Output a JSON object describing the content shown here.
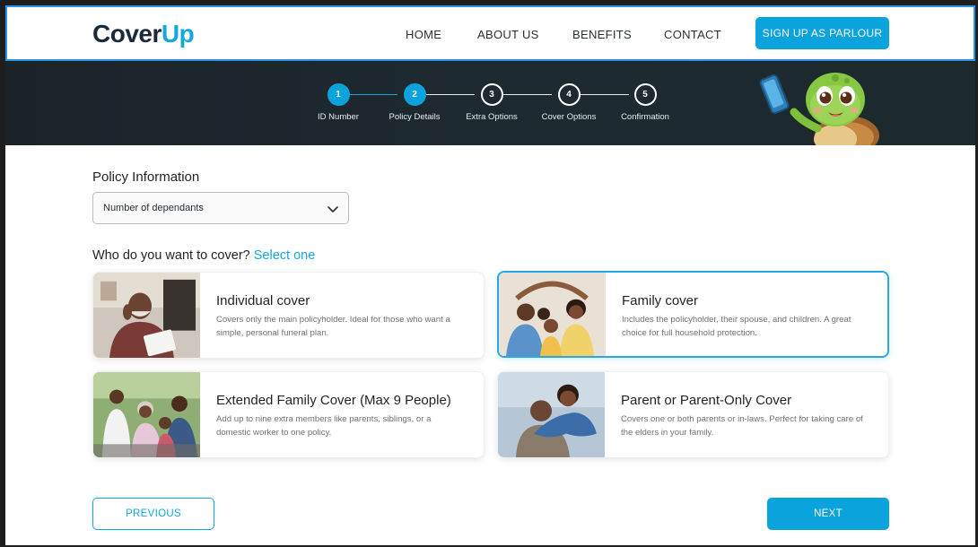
{
  "brand": {
    "logo_part1": "Cover",
    "logo_part2": "Up",
    "accent": "#0aa3dc",
    "dark": "#1b2a38"
  },
  "nav": {
    "items": [
      {
        "label": "HOME"
      },
      {
        "label": "ABOUT US"
      },
      {
        "label": "BENEFITS"
      },
      {
        "label": "CONTACT"
      }
    ],
    "cta_label": "SIGN UP AS PARLOUR"
  },
  "stepper": {
    "steps": [
      {
        "number": "1",
        "label": "ID Number",
        "state": "complete"
      },
      {
        "number": "2",
        "label": "Policy Details",
        "state": "current"
      },
      {
        "number": "3",
        "label": "Extra Options",
        "state": "pending"
      },
      {
        "number": "4",
        "label": "Cover Options",
        "state": "pending"
      },
      {
        "number": "5",
        "label": "Confirmation",
        "state": "pending"
      }
    ]
  },
  "policy": {
    "section_title": "Policy Information",
    "dependants_select_value": "Number of dependants"
  },
  "cover": {
    "question": "Who do you want to cover?",
    "question_hint": "Select one",
    "options": [
      {
        "title": "Individual cover",
        "description": "Covers only the main policyholder. Ideal for those who want a simple, personal funeral plan.",
        "selected": false
      },
      {
        "title": "Family cover",
        "description": "Includes the policyholder, their spouse, and children. A great choice for full household protection.",
        "selected": true
      },
      {
        "title": "Extended Family Cover (Max 9 People)",
        "description": "Add up to nine extra members like parents, siblings, or a domestic worker to one policy.",
        "selected": false
      },
      {
        "title": "Parent or Parent-Only Cover",
        "description": "Covers one or both parents or in-laws. Perfect for taking care of the elders in your family.",
        "selected": false
      }
    ]
  },
  "footer": {
    "previous_label": "PREVIOUS",
    "next_label": "NEXT"
  }
}
